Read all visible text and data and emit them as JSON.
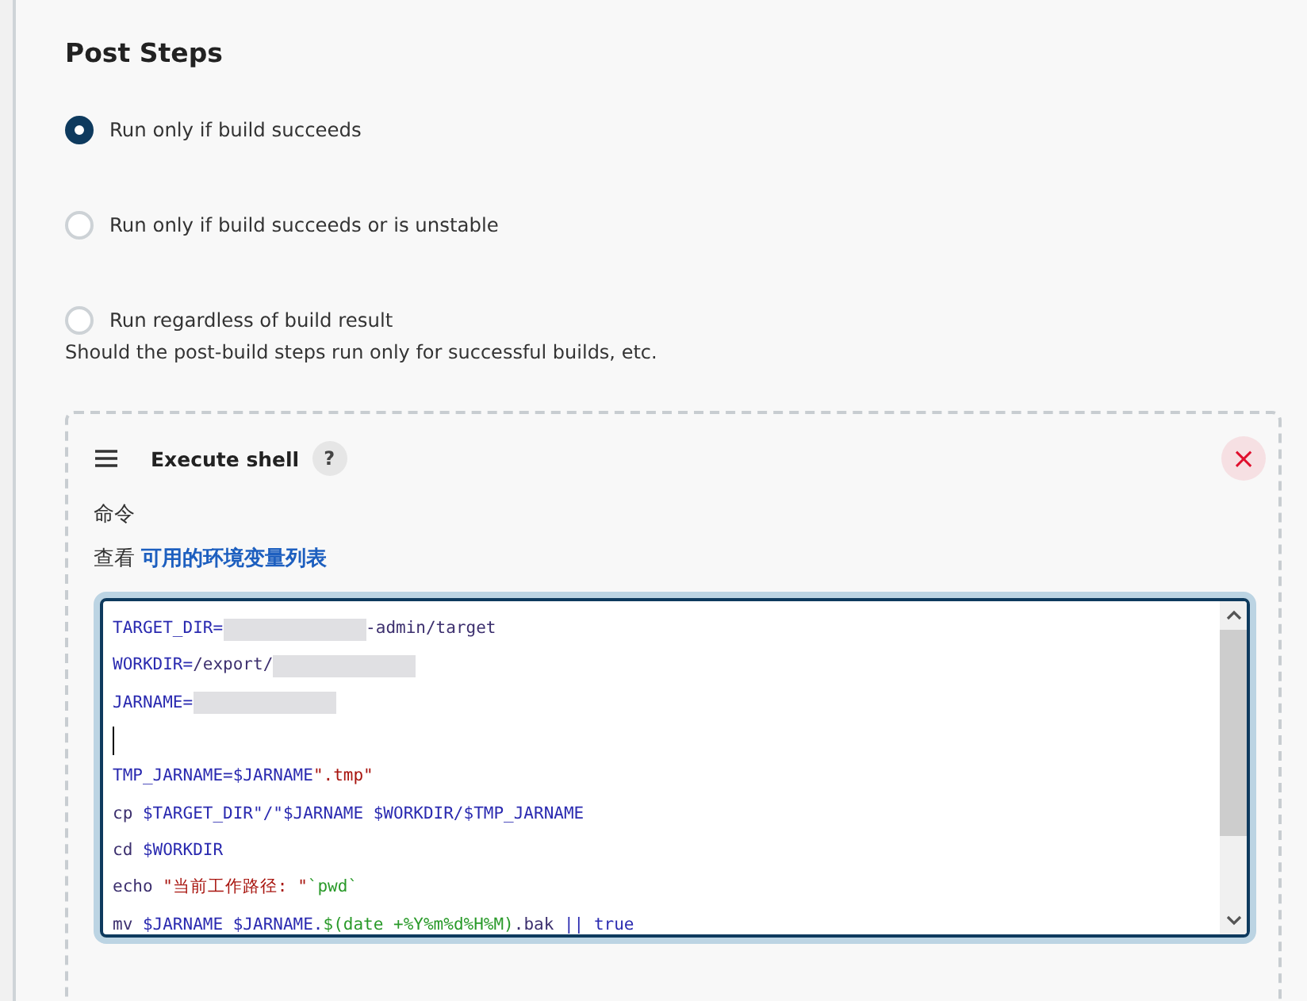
{
  "section": {
    "title": "Post Steps",
    "options": [
      {
        "label": "Run only if build succeeds",
        "selected": true
      },
      {
        "label": "Run only if build succeeds or is unstable",
        "selected": false
      },
      {
        "label": "Run regardless of build result",
        "selected": false
      }
    ],
    "description": "Should the post-build steps run only for successful builds, etc."
  },
  "step": {
    "title": "Execute shell",
    "help": "?",
    "close": "×",
    "field_label": "命令",
    "env_prefix": "查看",
    "env_link": "可用的环境变量列表",
    "lines": [
      {
        "kind": "code",
        "segments": [
          {
            "kind": "var",
            "text": "TARGET_DIR="
          },
          {
            "kind": "redacted"
          },
          {
            "kind": "plain",
            "text": "-admin/target"
          }
        ]
      },
      {
        "kind": "code",
        "segments": [
          {
            "kind": "var",
            "text": "WORKDIR="
          },
          {
            "kind": "plain",
            "text": "/export/"
          },
          {
            "kind": "redacted"
          }
        ]
      },
      {
        "kind": "code",
        "segments": [
          {
            "kind": "var",
            "text": "JARNAME="
          },
          {
            "kind": "redacted"
          }
        ]
      },
      {
        "kind": "cursor"
      },
      {
        "kind": "code",
        "segments": [
          {
            "kind": "var",
            "text": "TMP_JARNAME=$JARNAME"
          },
          {
            "kind": "string",
            "text": "\".tmp\""
          }
        ]
      },
      {
        "kind": "code",
        "segments": [
          {
            "kind": "plain",
            "text": "cp "
          },
          {
            "kind": "var",
            "text": "$TARGET_DIR\"/\"$JARNAME $WORKDIR/$TMP_JARNAME"
          }
        ]
      },
      {
        "kind": "code",
        "segments": [
          {
            "kind": "plain",
            "text": "cd "
          },
          {
            "kind": "var",
            "text": "$WORKDIR"
          }
        ]
      },
      {
        "kind": "code",
        "segments": [
          {
            "kind": "plain",
            "text": "echo "
          },
          {
            "kind": "string",
            "text": "\"当前工作路径: \""
          },
          {
            "kind": "sub",
            "text": "`pwd`"
          }
        ]
      },
      {
        "kind": "code",
        "segments": [
          {
            "kind": "plain",
            "text": "mv "
          },
          {
            "kind": "var",
            "text": "$JARNAME $JARNAME."
          },
          {
            "kind": "sub",
            "text": "$(date +%Y%m%d%H%M)"
          },
          {
            "kind": "plain",
            "text": ".bak "
          },
          {
            "kind": "var",
            "text": "|| true"
          }
        ]
      }
    ]
  }
}
